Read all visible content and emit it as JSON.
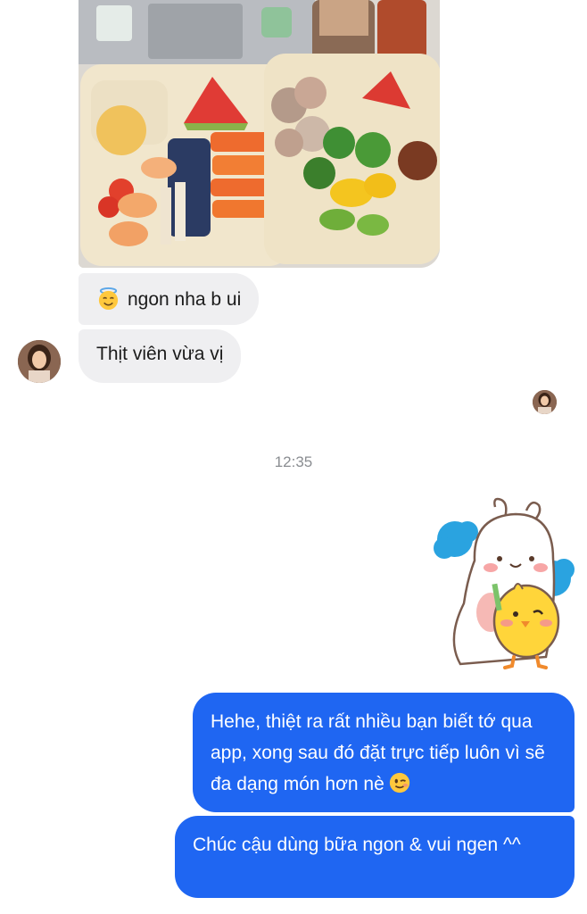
{
  "conversation": {
    "incoming": [
      {
        "text": "ngon nha b ui",
        "emoji": "smiling-face-with-halo"
      },
      {
        "text": "Thịt viên vừa vị"
      }
    ],
    "timestamp": "12:35",
    "outgoing": [
      {
        "text": "Hehe, thiệt ra rất nhiều bạn biết tớ qua app, xong sau đó đặt trực tiếp luôn vì sẽ đa dạng món hơn nè",
        "emoji": "winking-face"
      },
      {
        "text": "Chúc cậu dùng bữa ngon & vui ngen ^^"
      }
    ]
  },
  "colors": {
    "outgoing_bubble": "#1f66f2",
    "incoming_bubble": "#efeff1",
    "timestamp": "#8a8d91"
  }
}
